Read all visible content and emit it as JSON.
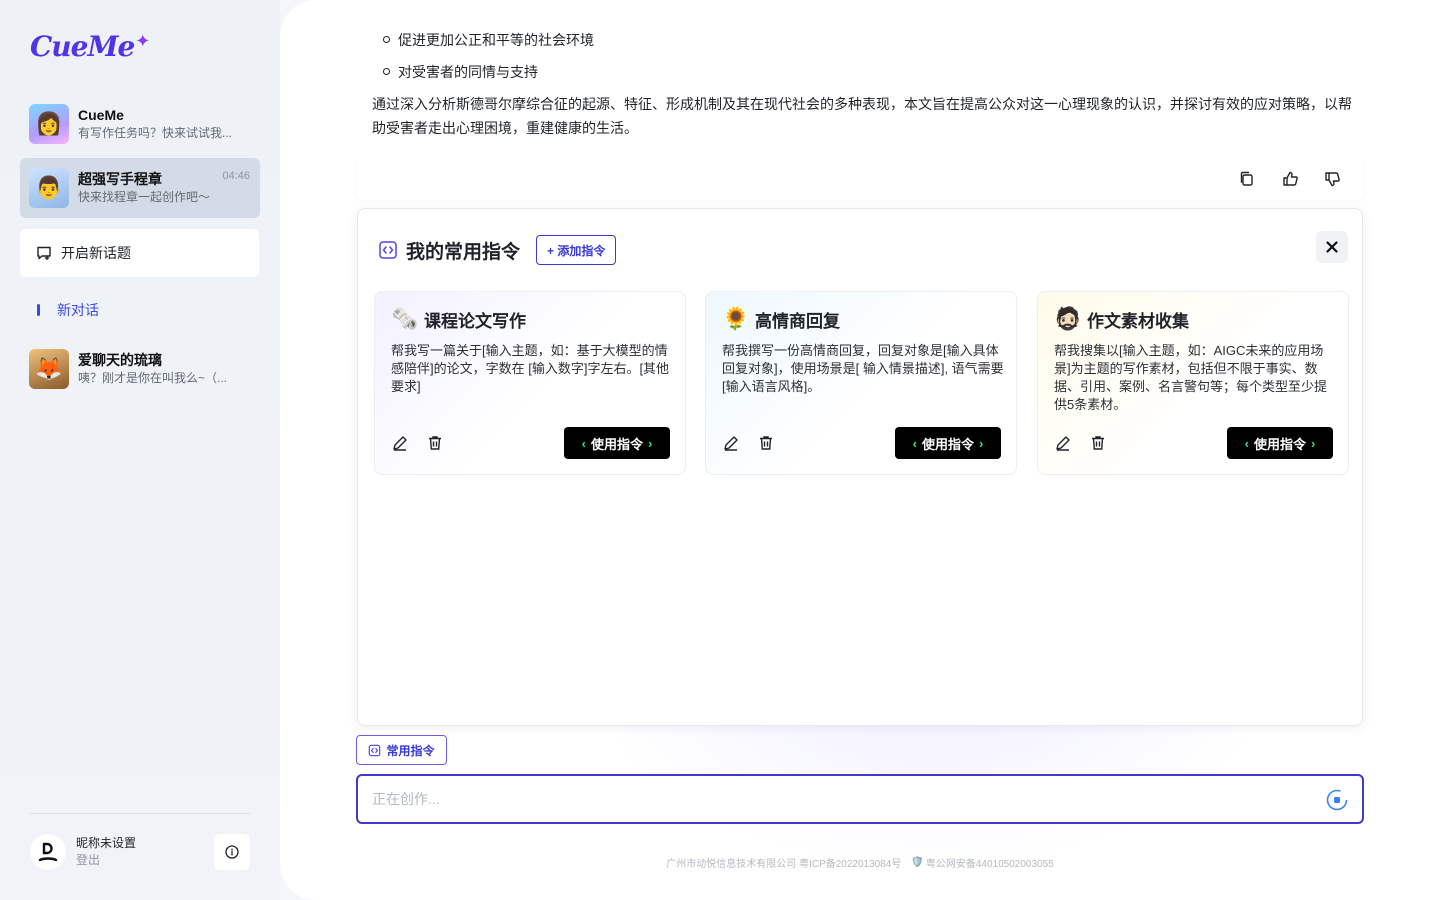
{
  "app": {
    "logo_text": "CueMe"
  },
  "sidebar": {
    "conversations": [
      {
        "name": "CueMe",
        "preview": "有写作任务吗？快来试试我...",
        "time": ""
      },
      {
        "name": "超强写手程章",
        "preview": "快来找程章一起创作吧～",
        "time": "04:46"
      },
      {
        "name": "爱聊天的琉璃",
        "preview": "咦？刚才是你在叫我么~（..."
      }
    ],
    "new_topic_label": "开启新话题",
    "nav_new_label": "新对话",
    "user": {
      "name": "昵称未设置",
      "logout": "登出"
    }
  },
  "message": {
    "bullets": [
      "促进更加公正和平等的社会环境",
      "对受害者的同情与支持"
    ],
    "paragraph": "通过深入分析斯德哥尔摩综合征的起源、特征、形成机制及其在现代社会的多种表现，本文旨在提高公众对这一心理现象的认识，并探讨有效的应对策略，以帮助受害者走出心理困境，重建健康的生活。"
  },
  "panel": {
    "title": "我的常用指令",
    "add_label": "+ 添加指令",
    "use_label": "使用指令",
    "cards": [
      {
        "emoji": "🗞️",
        "title": "课程论文写作",
        "desc": "帮我写一篇关于[输入主题，如：基于大模型的情感陪伴]的论文，字数在 [输入数字]字左右。[其他要求]"
      },
      {
        "emoji": "🌻",
        "title": "高情商回复",
        "desc": "帮我撰写一份高情商回复，回复对象是[输入具体回复对象]，使用场景是[ 输入情景描述], 语气需要[输入语言风格]。"
      },
      {
        "emoji": "🧔🏻",
        "title": "作文素材收集",
        "desc": "帮我搜集以[输入主题，如：AIGC未来的应用场景]为主题的写作素材，包括但不限于事实、数据、引用、案例、名言警句等；每个类型至少提供5条素材。"
      }
    ]
  },
  "chip_label": "常用指令",
  "input": {
    "placeholder": "正在创作..."
  },
  "footer": {
    "icp": "广州市动悦信息技术有限公司 粤ICP备2022013084号",
    "police_badge": "🛡️",
    "police": "粤公网安备44010502003055"
  },
  "colors": {
    "accent": "#4338ca",
    "brand": "#4f35e8",
    "use_chevron": "#31e07a"
  }
}
